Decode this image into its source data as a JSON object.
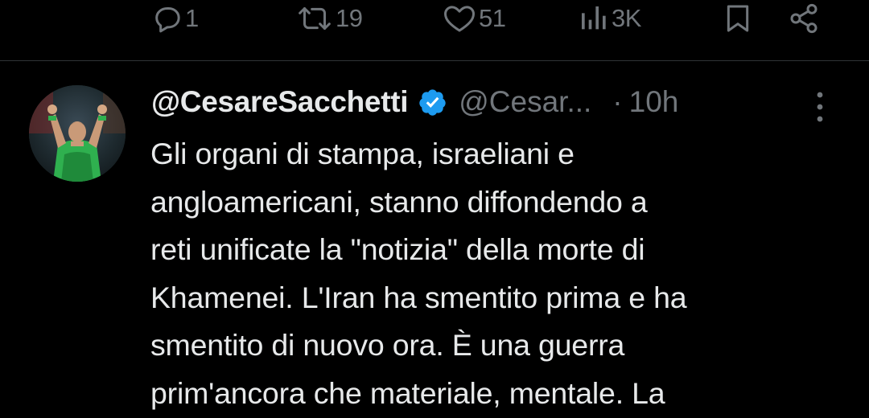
{
  "actions": {
    "reply": {
      "icon": "reply-icon",
      "count": "1"
    },
    "retweet": {
      "icon": "retweet-icon",
      "count": "19"
    },
    "like": {
      "icon": "heart-icon",
      "count": "51"
    },
    "views": {
      "icon": "views-icon",
      "count": "3K"
    },
    "bookmark": {
      "icon": "bookmark-icon"
    },
    "share": {
      "icon": "share-icon"
    }
  },
  "tweet": {
    "display_name": "@CesareSacchetti",
    "verified": true,
    "handle": "@Cesar...",
    "separator": "·",
    "time": "10h",
    "text_lines": [
      "Gli organi di stampa, israeliani e",
      "angloamericani, stanno diffondendo a",
      "reti unificate la \"notizia\" della morte di",
      "Khamenei. L'Iran ha smentito prima e ha",
      "smentito di nuovo ora. È una guerra",
      "prim'ancora che materiale, mentale. La"
    ]
  },
  "colors": {
    "background": "#000000",
    "text_primary": "#e7e9ea",
    "text_secondary": "#71767b",
    "divider": "#2f3336",
    "verified_badge": "#1d9bf0"
  }
}
